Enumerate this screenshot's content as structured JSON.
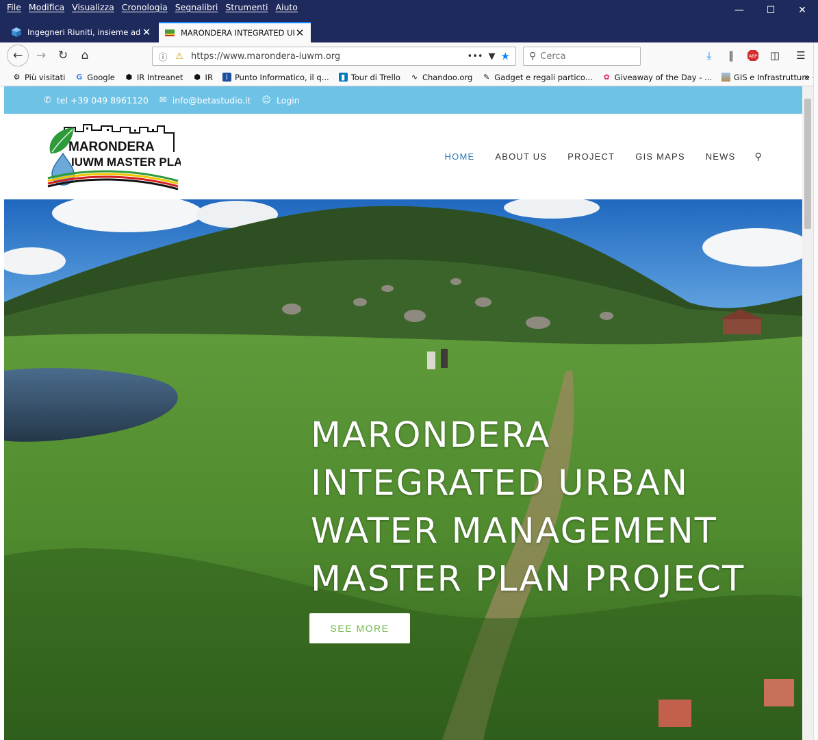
{
  "browser": {
    "menu": [
      "File",
      "Modifica",
      "Visualizza",
      "Cronologia",
      "Segnalibri",
      "Strumenti",
      "Aiuto"
    ],
    "tabs": [
      {
        "label": "Ingegneri Riuniti, insieme ad al",
        "icon": "cube-icon",
        "active": false
      },
      {
        "label": "MARONDERA INTEGRATED URB",
        "icon": "site-favicon",
        "active": true
      }
    ],
    "url": "https://www.marondera-iuwm.org",
    "search_placeholder": "Cerca",
    "bookmarks": [
      {
        "label": "Più visitati",
        "icon": "gear-icon"
      },
      {
        "label": "Google",
        "icon": "google-icon"
      },
      {
        "label": "IR Intreanet",
        "icon": "ir-icon"
      },
      {
        "label": "IR",
        "icon": "ir-icon"
      },
      {
        "label": "Punto Informatico, il q...",
        "icon": "pi-icon"
      },
      {
        "label": "Tour di Trello",
        "icon": "trello-icon"
      },
      {
        "label": "Chandoo.org",
        "icon": "rss-icon"
      },
      {
        "label": "Gadget e regali partico...",
        "icon": "gift-icon"
      },
      {
        "label": "Giveaway of the Day - ...",
        "icon": "giveaway-icon"
      },
      {
        "label": "GIS e Infrastrutture – Il ...",
        "icon": "gis-icon"
      }
    ]
  },
  "site": {
    "topbar": {
      "phone": "tel +39 049 8961120",
      "email": "info@betastudio.it",
      "login": "Login"
    },
    "logo": {
      "line1": "MARONDERA",
      "line2": "IUWM MASTER PLAN"
    },
    "nav": [
      "HOME",
      "ABOUT US",
      "PROJECT",
      "GIS MAPS",
      "NEWS"
    ],
    "nav_active": "HOME",
    "hero": {
      "title_lines": [
        "MARONDERA",
        "INTEGRATED URBAN",
        "WATER MANAGEMENT",
        "MASTER PLAN PROJECT"
      ],
      "button": "SEE MORE"
    }
  },
  "colors": {
    "titlebar": "#1f2a5c",
    "topbar": "#6ec2e6",
    "nav_active": "#2b78b9",
    "button_text": "#6cb645"
  }
}
